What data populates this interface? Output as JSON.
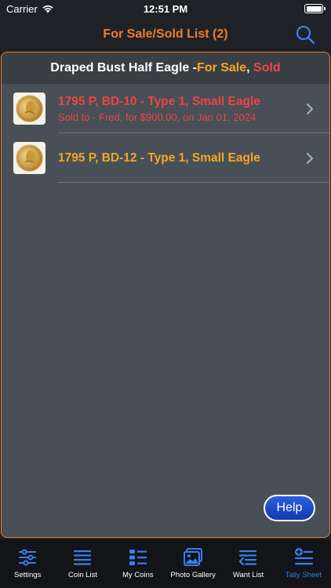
{
  "status_bar": {
    "carrier": "Carrier",
    "time": "12:51 PM"
  },
  "nav": {
    "title": "For Sale/Sold List (2)"
  },
  "section": {
    "title_prefix": "Draped Bust Half Eagle - ",
    "for_sale": "For Sale",
    "separator": ", ",
    "sold": "Sold"
  },
  "items": [
    {
      "title": "1795 P, BD-10 - Type 1, Small Eagle",
      "subtitle": "Sold to - Fred, for $900.00, on Jan 01, 2024",
      "status": "sold"
    },
    {
      "title": "1795 P, BD-12 - Type 1, Small Eagle",
      "subtitle": "",
      "status": "for-sale"
    }
  ],
  "help_label": "Help",
  "tabs": [
    {
      "label": "Settings",
      "icon": "sliders-icon"
    },
    {
      "label": "Coin List",
      "icon": "list-icon"
    },
    {
      "label": "My Coins",
      "icon": "grid-list-icon"
    },
    {
      "label": "Photo Gallery",
      "icon": "photos-icon"
    },
    {
      "label": "Want List",
      "icon": "want-list-icon"
    },
    {
      "label": "Tally Sheet",
      "icon": "tally-sheet-icon",
      "active": true
    }
  ],
  "colors": {
    "accent": "#f27a2e",
    "sold": "#f04444",
    "for_sale": "#f5a623",
    "active_tab": "#3b7cf0"
  }
}
